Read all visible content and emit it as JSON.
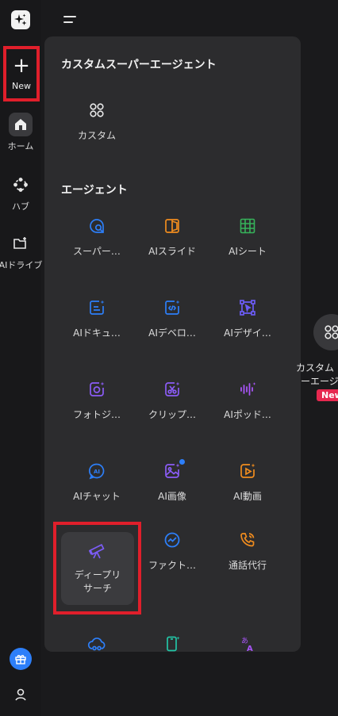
{
  "sidebar": {
    "new_label": "New",
    "items": [
      {
        "label": "ホーム",
        "icon": "home-icon"
      },
      {
        "label": "ハブ",
        "icon": "hub-icon"
      },
      {
        "label": "AIドライブ",
        "icon": "folder-plus-icon"
      }
    ],
    "bottom_icons": [
      "gift-icon",
      "user-icon"
    ]
  },
  "panel": {
    "custom_section": {
      "title": "カスタムスーパーエージェント",
      "items": [
        {
          "label": "カスタム",
          "icon": "grid-circles-icon"
        }
      ]
    },
    "agents_section": {
      "title": "エージェント",
      "items": [
        {
          "label": "スーパー…",
          "icon": "chat-search-icon"
        },
        {
          "label": "AIスライド",
          "icon": "slides-icon"
        },
        {
          "label": "AIシート",
          "icon": "sheet-icon"
        },
        {
          "label": "AIドキュ…",
          "icon": "doc-sparkle-icon"
        },
        {
          "label": "AIデベロ…",
          "icon": "code-sparkle-icon"
        },
        {
          "label": "AIデザイ…",
          "icon": "design-icon"
        },
        {
          "label": "フォトジ…",
          "icon": "camera-sparkle-icon"
        },
        {
          "label": "クリップ…",
          "icon": "clip-icon"
        },
        {
          "label": "AIポッド…",
          "icon": "audio-wave-icon"
        },
        {
          "label": "AIチャット",
          "icon": "ai-chat-icon"
        },
        {
          "label": "AI画像",
          "icon": "image-sparkle-icon"
        },
        {
          "label": "AI動画",
          "icon": "video-sparkle-icon"
        },
        {
          "label": "ディープリサーチ",
          "icon": "telescope-icon"
        },
        {
          "label": "ファクト…",
          "icon": "fact-check-icon"
        },
        {
          "label": "通話代行",
          "icon": "phone-call-icon"
        },
        {
          "label": "",
          "icon": "cloud-icon"
        },
        {
          "label": "",
          "icon": "phone-sparkle-icon"
        },
        {
          "label": "",
          "icon": "translate-icon"
        }
      ]
    }
  },
  "right_card": {
    "line1": "カスタム",
    "line2": "ーエージ",
    "badge": "New"
  },
  "colors": {
    "background": "#1a1a1c",
    "panel": "#2c2c2e",
    "highlight": "#e01f2b",
    "accent_blue": "#2d7ff9",
    "badge": "#e6284f"
  }
}
